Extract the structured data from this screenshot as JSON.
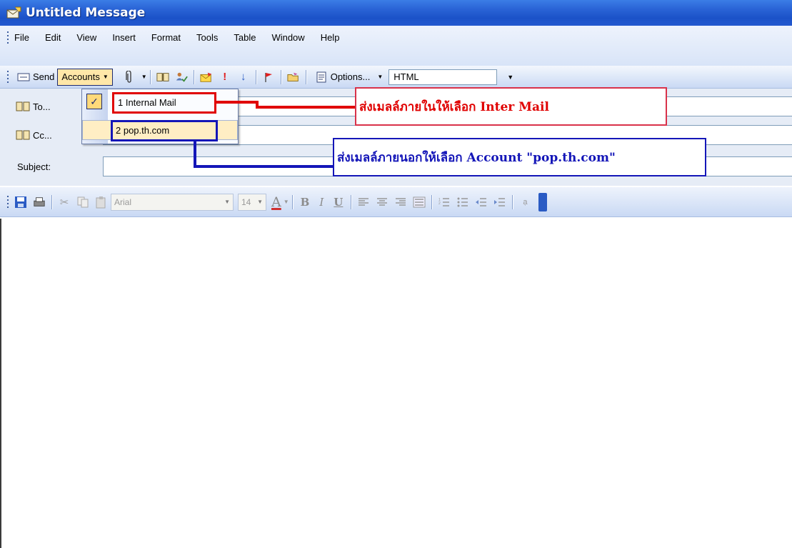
{
  "window": {
    "title": "Untitled Message",
    "icon": "envelope-icon"
  },
  "menu": {
    "items": [
      "File",
      "Edit",
      "View",
      "Insert",
      "Format",
      "Tools",
      "Table",
      "Window",
      "Help"
    ]
  },
  "toolbar": {
    "send_label": "Send",
    "accounts_label": "Accounts",
    "options_label": "Options...",
    "format_value": "HTML"
  },
  "fields": {
    "to_label": "To...",
    "cc_label": "Cc...",
    "subject_label": "Subject:",
    "to_value": "",
    "cc_value": "",
    "subject_value": ""
  },
  "format_toolbar": {
    "font_value": "Arial",
    "size_value": "14",
    "bold_label": "B",
    "italic_label": "I",
    "underline_label": "U",
    "font_color_label": "A"
  },
  "accounts_menu": {
    "items": [
      {
        "label": "1 Internal Mail",
        "checked": true
      },
      {
        "label": "2 pop.th.com",
        "checked": false
      }
    ]
  },
  "annotations": {
    "internal_note": "ส่งเมลล์ภายในให้เลือก Inter Mail",
    "external_note": "ส่งเมลล์ภายนอกให้เลือก Account \"pop.th.com\"",
    "internal_color": "#e00000",
    "external_color": "#1416b8"
  }
}
